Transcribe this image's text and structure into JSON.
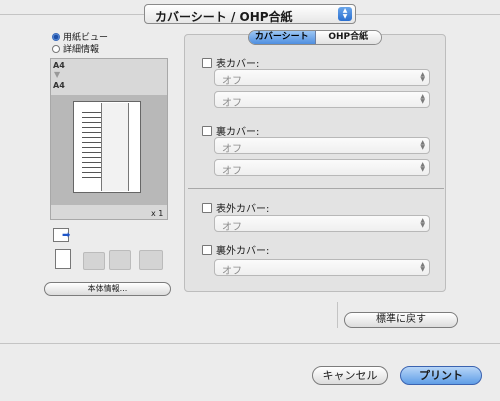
{
  "header": {
    "popup_value": "カバーシート / OHP合紙"
  },
  "left": {
    "radio_paper_view": "用紙ビュー",
    "radio_detail_settings": "詳細情報",
    "size_top": "A4",
    "size_bottom": "A4",
    "copies": "x 1",
    "device_info_button": "本体情報..."
  },
  "tabs": [
    {
      "label": "カバーシート",
      "active": true
    },
    {
      "label": "OHP合紙",
      "active": false
    }
  ],
  "front_cover": {
    "label": "表カバー:",
    "select1": "オフ",
    "select2": "オフ"
  },
  "back_cover": {
    "label": "裏カバー:",
    "select1": "オフ",
    "select2": "オフ"
  },
  "front_outer_cover": {
    "label": "表外カバー:",
    "select1": "オフ"
  },
  "back_outer_cover": {
    "label": "裏外カバー:",
    "select1": "オフ"
  },
  "restore_defaults_button": "標準に戻す",
  "cancel_button": "キャンセル",
  "print_button": "プリント"
}
